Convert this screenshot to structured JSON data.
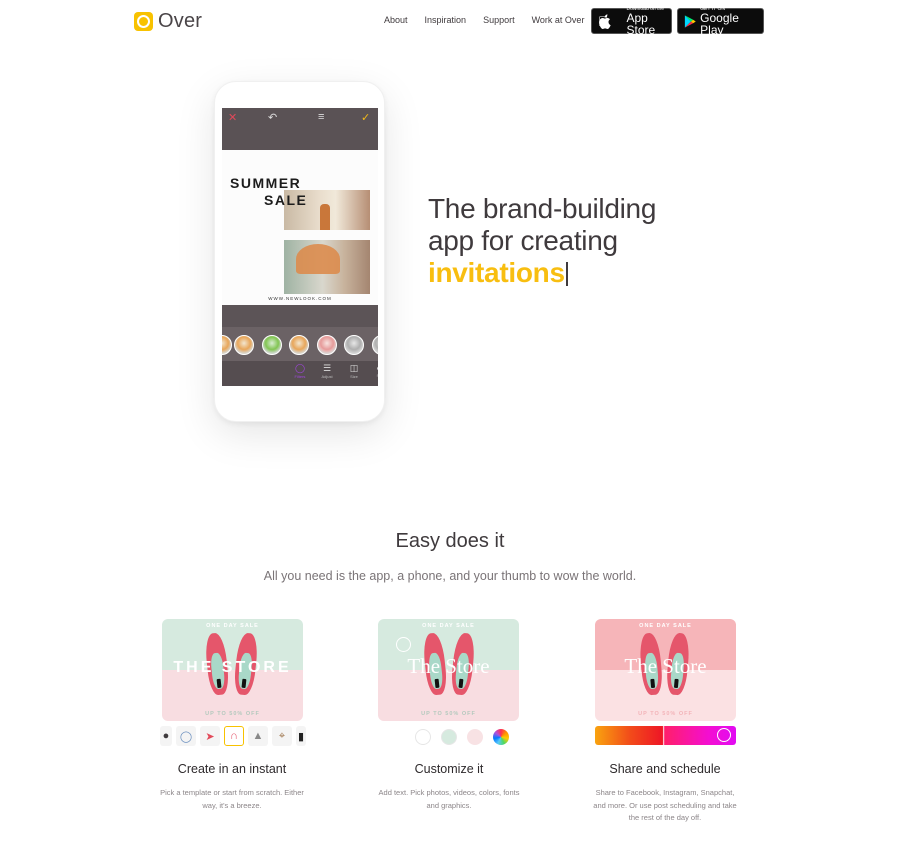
{
  "header": {
    "brand": "Over",
    "nav": [
      "About",
      "Inspiration",
      "Support",
      "Work at Over"
    ],
    "app_store": {
      "small": "Download on the",
      "big": "App Store"
    },
    "google_play": {
      "small": "GET IT ON",
      "big": "Google Play"
    }
  },
  "phone": {
    "topbar_icons": [
      "close-icon",
      "undo-icon",
      "layers-icon",
      "check-icon"
    ],
    "poster": {
      "line1": "SUMMER",
      "line2": "SALE",
      "url": "WWW.NEWLOOK.COM"
    },
    "tools": [
      {
        "label": "Filters",
        "icon": "filters-icon",
        "active": true
      },
      {
        "label": "Adjust",
        "icon": "adjust-icon",
        "active": false
      },
      {
        "label": "Size",
        "icon": "size-icon",
        "active": false
      },
      {
        "label": "Sh",
        "icon": "shadow-icon",
        "active": false
      }
    ]
  },
  "hero": {
    "line1": "The brand-building",
    "line2": "app for creating",
    "accent_word": "invitations",
    "accent_color": "#f8be10"
  },
  "section": {
    "title": "Easy does it",
    "subtitle": "All you need is the app, a phone, and your thumb to wow the world."
  },
  "cards": [
    {
      "top_text": "ONE DAY SALE",
      "title_text": "THE STORE",
      "bottom_text": "UP TO 50% OFF"
    },
    {
      "top_text": "ONE DAY SALE",
      "title_text": "The Store",
      "bottom_text": "UP TO 50% OFF"
    },
    {
      "top_text": "ONE DAY SALE",
      "title_text": "The Store",
      "bottom_text": "UP TO 50% OFF"
    }
  ],
  "features": [
    {
      "title": "Create in an instant",
      "desc": "Pick a template or start from scratch. Either way, it's a breeze."
    },
    {
      "title": "Customize it",
      "desc": "Add text. Pick photos, videos, colors, fonts and graphics."
    },
    {
      "title": "Share and schedule",
      "desc": "Share to Facebook, Instagram, Snapchat, and more. Or use post scheduling and take the rest of the day off."
    }
  ],
  "colors": {
    "brand_yellow": "#f8c200",
    "text_dark": "#3f3a3d",
    "filter_active": "#a246e0"
  }
}
